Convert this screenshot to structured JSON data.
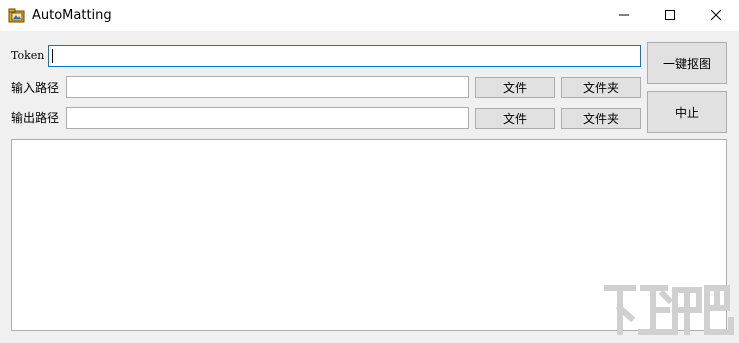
{
  "window": {
    "title": "AutoMatting",
    "app_icon": "folder-image-icon",
    "controls": [
      "minimize-icon",
      "maximize-icon",
      "close-icon"
    ]
  },
  "form": {
    "token_label": "Token",
    "token_value": "",
    "input_path_label": "输入路径",
    "input_path_value": "",
    "output_path_label": "输出路径",
    "output_path_value": ""
  },
  "buttons": {
    "input_file": "文件",
    "input_folder": "文件夹",
    "output_file": "文件",
    "output_folder": "文件夹",
    "one_click_matting": "一键抠图",
    "stop": "中止"
  },
  "log": {
    "content": ""
  },
  "colors": {
    "window_bg": "#f0f0f0",
    "titlebar_bg": "#ffffff",
    "focus_border": "#0078d7",
    "button_bg": "#e1e1e1",
    "border": "#adadad"
  }
}
